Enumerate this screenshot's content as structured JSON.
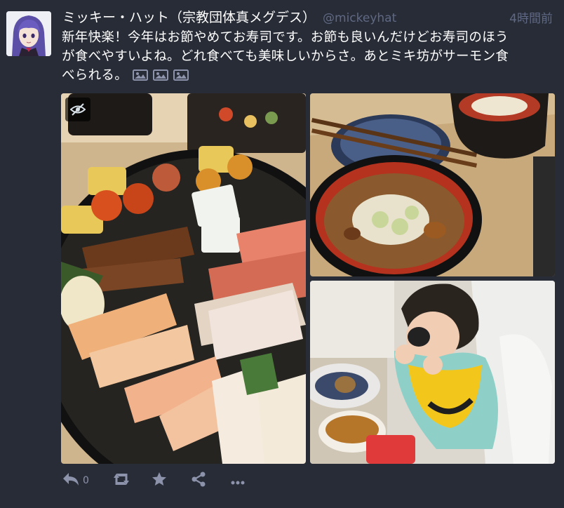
{
  "status": {
    "display_name": "ミッキー・ハット（宗教団体真メグデス）",
    "acct": "@mickeyhat",
    "relative_time": "4時間前",
    "content_lines": [
      "新年快楽！今年はお節やめてお寿司です。お節も良いんだけどお寿司のほう",
      "が食べやすいよね。どれ食べても美味しいからさ。あとミキ坊がサーモン食",
      "べられる。"
    ],
    "attachment_icons": [
      "picture-icon",
      "picture-icon",
      "picture-icon"
    ],
    "media": [
      {
        "icon": "sushi-platter-photo"
      },
      {
        "icon": "miso-soup-photo"
      },
      {
        "icon": "child-eating-photo"
      }
    ],
    "hide_media_icon": "eye-slash-icon"
  },
  "actions": {
    "reply_count": "0",
    "icons": [
      "reply-icon",
      "boost-icon",
      "favourite-icon",
      "share-icon",
      "more-icon"
    ]
  },
  "colors": {
    "background": "#282c37",
    "muted": "#606984",
    "action_icon": "#8d93ab",
    "text": "#ffffff"
  }
}
